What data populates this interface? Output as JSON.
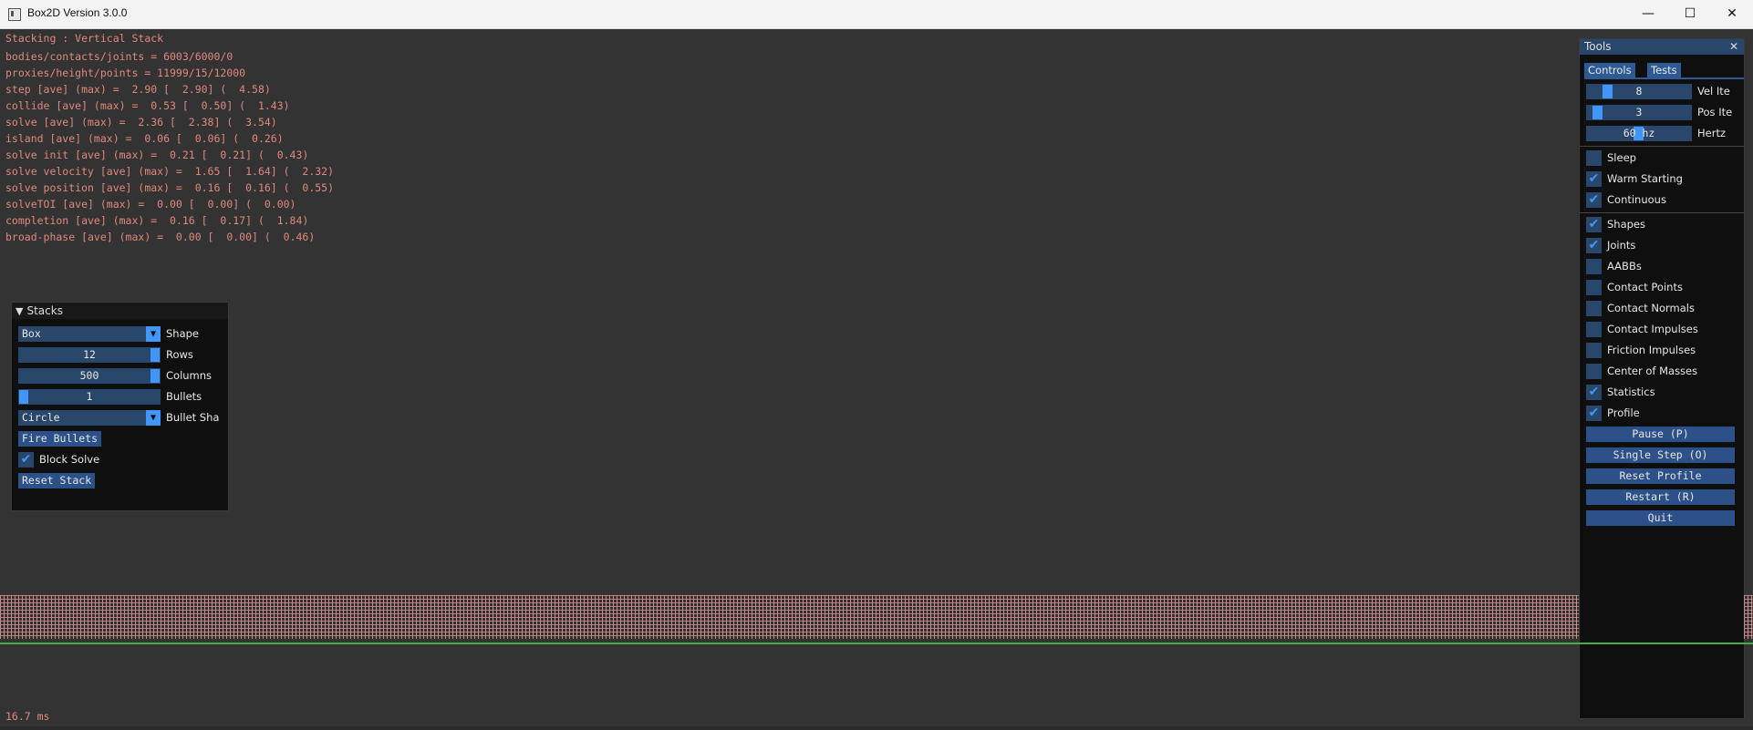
{
  "window": {
    "title": "Box2D Version 3.0.0",
    "minimize_icon": "minimize-icon",
    "maximize_icon": "maximize-icon",
    "close_icon": "close-icon"
  },
  "stats": {
    "sample_title": "Stacking : Vertical Stack",
    "lines": [
      "bodies/contacts/joints = 6003/6000/0",
      "proxies/height/points = 11999/15/12000",
      "step [ave] (max) =  2.90 [  2.90] (  4.58)",
      "collide [ave] (max) =  0.53 [  0.50] (  1.43)",
      "solve [ave] (max) =  2.36 [  2.38] (  3.54)",
      "island [ave] (max) =  0.06 [  0.06] (  0.26)",
      "solve init [ave] (max) =  0.21 [  0.21] (  0.43)",
      "solve velocity [ave] (max) =  1.65 [  1.64] (  2.32)",
      "solve position [ave] (max) =  0.16 [  0.16] (  0.55)",
      "solveTOI [ave] (max) =  0.00 [  0.00] (  0.00)",
      "completion [ave] (max) =  0.16 [  0.17] (  1.84)",
      "broad-phase [ave] (max) =  0.00 [  0.00] (  0.46)"
    ],
    "frame_time": "16.7 ms"
  },
  "stacks_panel": {
    "title": "Stacks",
    "shape": {
      "value": "Box",
      "label": "Shape"
    },
    "rows": {
      "value": "12",
      "label": "Rows",
      "level": 1.0
    },
    "columns": {
      "value": "500",
      "label": "Columns",
      "level": 1.0
    },
    "bullets": {
      "value": "1",
      "label": "Bullets",
      "level": 0.0
    },
    "bullet_shape": {
      "value": "Circle",
      "label": "Bullet Sha"
    },
    "fire_bullets": "Fire Bullets",
    "block_solve": {
      "label": "Block Solve",
      "checked": true
    },
    "reset_stack": "Reset Stack"
  },
  "tools_panel": {
    "title": "Tools",
    "close_glyph": "✕",
    "tabs": [
      "Controls",
      "Tests"
    ],
    "sliders": [
      {
        "value": "8",
        "label": "Vel Ite"
      },
      {
        "value": "3",
        "label": "Pos Ite"
      },
      {
        "value": "60 hz",
        "label": "Hertz"
      }
    ],
    "checkboxes_a": [
      {
        "label": "Sleep",
        "checked": false
      },
      {
        "label": "Warm Starting",
        "checked": true
      },
      {
        "label": "Continuous",
        "checked": true
      }
    ],
    "checkboxes_b": [
      {
        "label": "Shapes",
        "checked": true
      },
      {
        "label": "Joints",
        "checked": true
      },
      {
        "label": "AABBs",
        "checked": false
      },
      {
        "label": "Contact Points",
        "checked": false
      },
      {
        "label": "Contact Normals",
        "checked": false
      },
      {
        "label": "Contact Impulses",
        "checked": false
      },
      {
        "label": "Friction Impulses",
        "checked": false
      },
      {
        "label": "Center of Masses",
        "checked": false
      },
      {
        "label": "Statistics",
        "checked": true
      },
      {
        "label": "Profile",
        "checked": true
      }
    ],
    "buttons": [
      "Pause (P)",
      "Single Step (O)",
      "Reset Profile",
      "Restart (R)",
      "Quit"
    ]
  },
  "colors": {
    "stats_text": "#e0887e",
    "panel_bg": "#0f0f0f",
    "widget_bg": "#29466b",
    "accent": "#4296fa",
    "ground": "#3fae4b"
  }
}
